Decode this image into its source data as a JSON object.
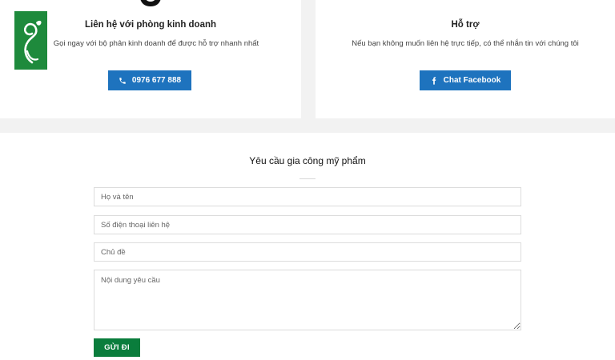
{
  "contact_cards": {
    "sales": {
      "title": "Liên hệ với phòng kinh doanh",
      "description": "Gọi ngay với bộ phân kinh doanh để được hỗ trợ nhanh nhất",
      "button_label": "0976 677 888",
      "button_icon": "phone-icon"
    },
    "support": {
      "title": "Hỗ trợ",
      "description": "Nếu bạn không muốn liên hệ trực tiếp, có thể nhắn tin với chúng tôi",
      "button_label": "Chat Facebook",
      "button_icon": "facebook-icon"
    }
  },
  "form": {
    "title": "Yêu cầu gia công mỹ phẩm",
    "fields": {
      "name_placeholder": "Họ và tên",
      "phone_placeholder": "Số điện thoại liên hệ",
      "subject_placeholder": "Chủ đề",
      "content_placeholder": "Nội dung yêu cầu"
    },
    "submit_label": "GỬI ĐI"
  },
  "colors": {
    "primary_blue": "#1e73be",
    "brand_green": "#0a7d3c",
    "logo_green": "#1e8a3c",
    "page_bg": "#f2f2f2"
  }
}
